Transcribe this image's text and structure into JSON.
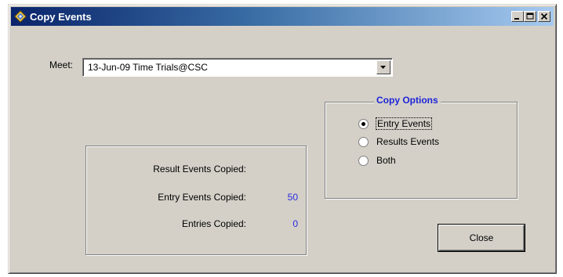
{
  "window": {
    "title": "Copy Events",
    "icon": "app-icon"
  },
  "meet": {
    "label": "Meet:",
    "selected": "13-Jun-09 Time Trials@CSC"
  },
  "copy_options": {
    "title": "Copy Options",
    "options": [
      {
        "label": "Entry Events",
        "checked": true
      },
      {
        "label": "Results Events",
        "checked": false
      },
      {
        "label": "Both",
        "checked": false
      }
    ]
  },
  "stats": [
    {
      "label": "Result Events Copied:",
      "value": ""
    },
    {
      "label": "Entry Events Copied:",
      "value": "50"
    },
    {
      "label": "Entries Copied:",
      "value": "0"
    }
  ],
  "buttons": {
    "close": "Close"
  },
  "colors": {
    "legend": "#1c24d8",
    "value": "#2a2ae0",
    "titlebar_start": "#0a246a",
    "titlebar_end": "#a6caf0"
  }
}
